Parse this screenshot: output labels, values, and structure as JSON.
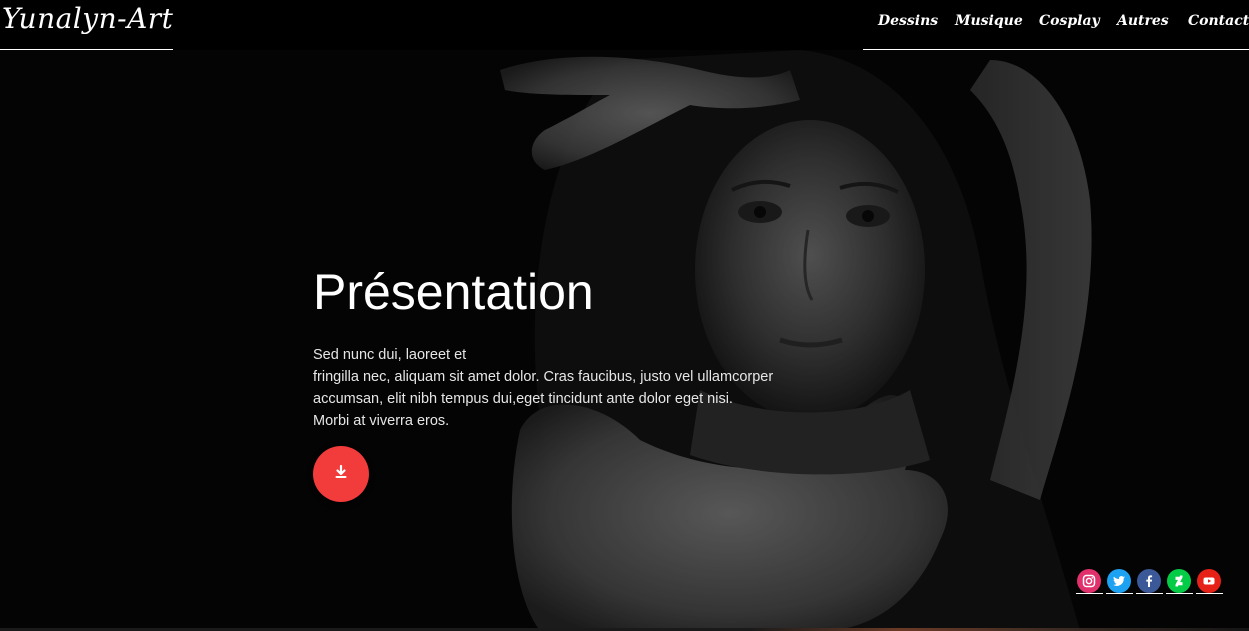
{
  "site": {
    "logo_text": "Yunalyn-Art"
  },
  "nav": {
    "items": [
      {
        "label": "Dessins"
      },
      {
        "label": "Musique"
      },
      {
        "label": "Cosplay"
      },
      {
        "label": "Autres"
      },
      {
        "label": "Contact"
      }
    ]
  },
  "hero": {
    "title": "Présentation",
    "paragraph_lines": [
      "Sed nunc dui, laoreet et",
      "fringilla nec, aliquam sit amet dolor. Cras faucibus, justo vel ullamcorper",
      "accumsan, elit nibh tempus dui,eget tincidunt ante dolor eget nisi.",
      "Morbi at viverra eros."
    ],
    "button_icon": "download-icon",
    "button_color": "#f23b3b"
  },
  "social": {
    "links": [
      {
        "icon": "instagram-icon",
        "color": "#e1306c"
      },
      {
        "icon": "twitter-icon",
        "color": "#1da1f2"
      },
      {
        "icon": "facebook-icon",
        "color": "#3b5998"
      },
      {
        "icon": "deviantart-icon",
        "color": "#05cc47"
      },
      {
        "icon": "youtube-icon",
        "color": "#e62117"
      }
    ]
  }
}
